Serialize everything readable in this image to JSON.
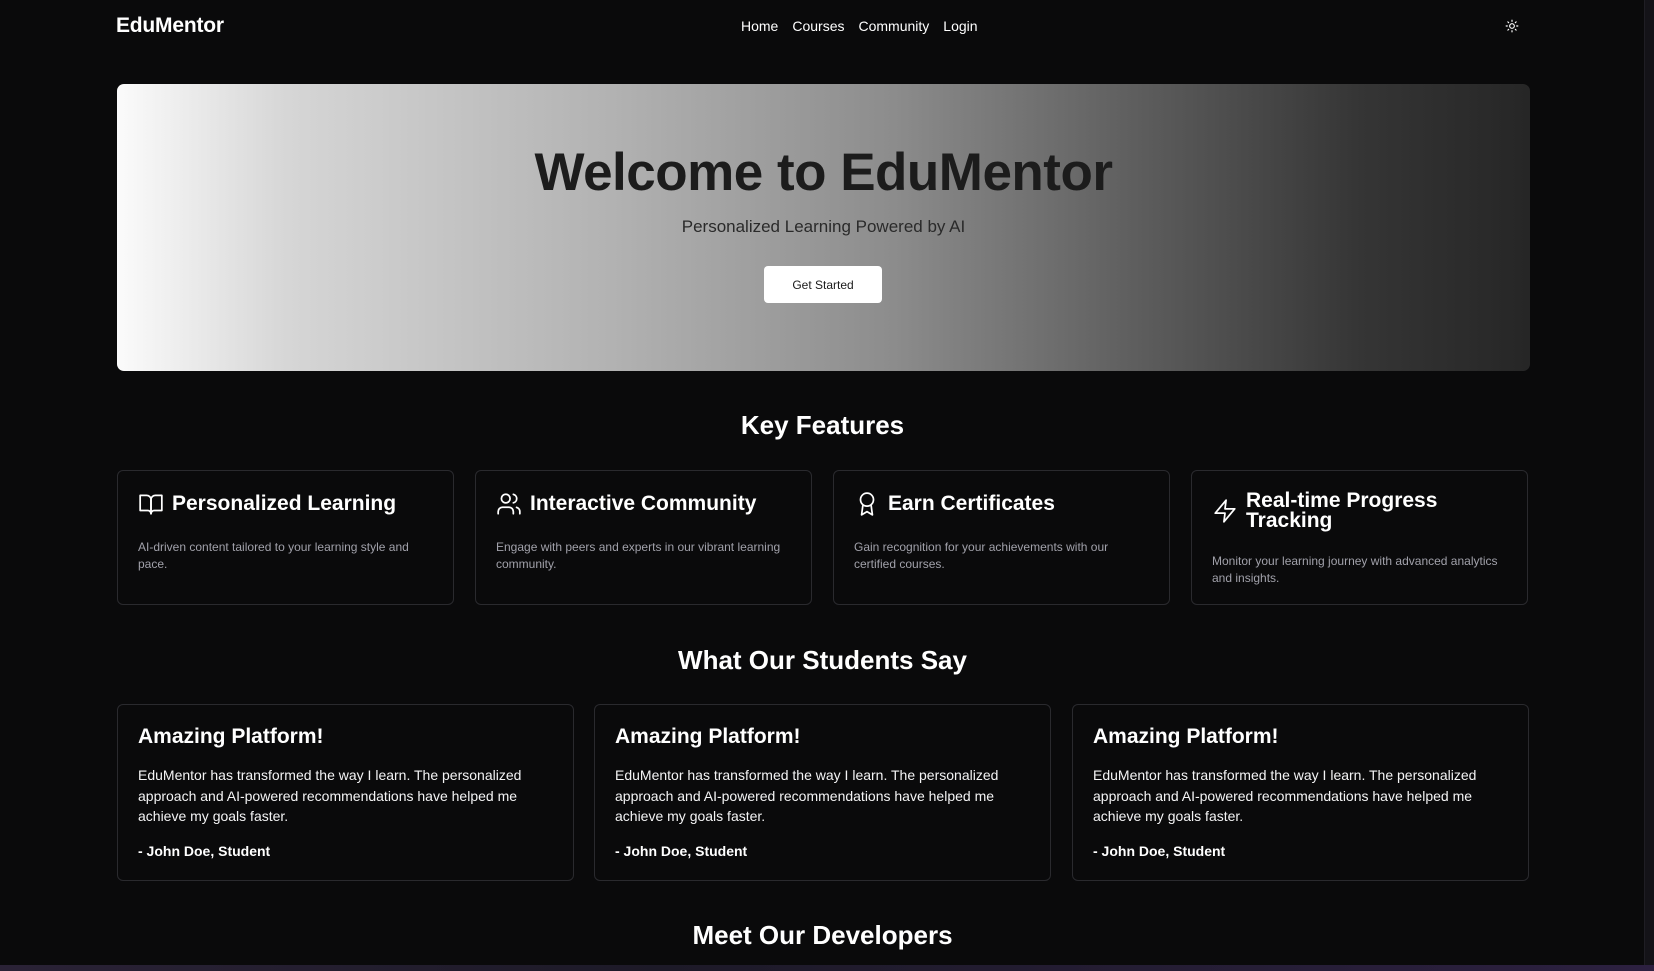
{
  "nav": {
    "brand": "EduMentor",
    "links": [
      "Home",
      "Courses",
      "Community",
      "Login"
    ],
    "theme_toggle_icon": "sun-icon"
  },
  "hero": {
    "title": "Welcome to EduMentor",
    "subtitle": "Personalized Learning Powered by AI",
    "cta_label": "Get Started"
  },
  "features": {
    "heading": "Key Features",
    "items": [
      {
        "icon": "book-open-icon",
        "title": "Personalized Learning",
        "description": "AI-driven content tailored to your learning style and pace."
      },
      {
        "icon": "users-icon",
        "title": "Interactive Community",
        "description": "Engage with peers and experts in our vibrant learning community."
      },
      {
        "icon": "award-icon",
        "title": "Earn Certificates",
        "description": "Gain recognition for your achievements with our certified courses."
      },
      {
        "icon": "zap-icon",
        "title": "Real-time Progress Tracking",
        "description": "Monitor your learning journey with advanced analytics and insights."
      }
    ]
  },
  "testimonials": {
    "heading": "What Our Students Say",
    "items": [
      {
        "title": "Amazing Platform!",
        "quote": "EduMentor has transformed the way I learn. The personalized approach and AI-powered recommendations have helped me achieve my goals faster.",
        "author": "- John Doe, Student"
      },
      {
        "title": "Amazing Platform!",
        "quote": "EduMentor has transformed the way I learn. The personalized approach and AI-powered recommendations have helped me achieve my goals faster.",
        "author": "- John Doe, Student"
      },
      {
        "title": "Amazing Platform!",
        "quote": "EduMentor has transformed the way I learn. The personalized approach and AI-powered recommendations have helped me achieve my goals faster.",
        "author": "- John Doe, Student"
      }
    ]
  },
  "developers": {
    "heading": "Meet Our Developers"
  },
  "colors": {
    "background": "#0a0a0b",
    "card_border": "#2a2a2e",
    "muted_text": "#a1a1aa"
  }
}
